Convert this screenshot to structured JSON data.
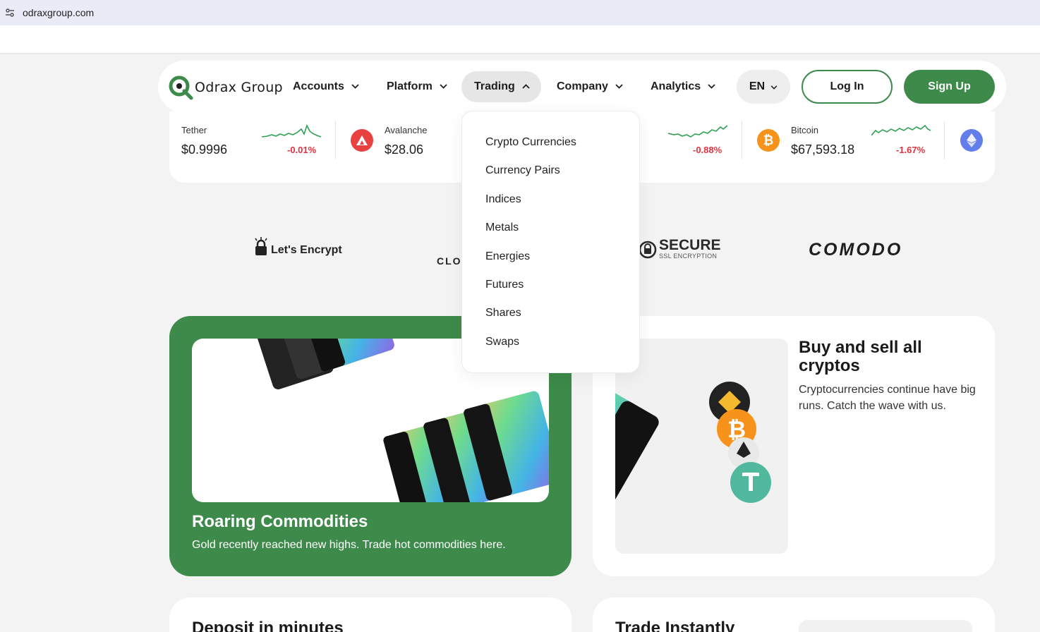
{
  "browser": {
    "url": "odraxgroup.com",
    "site_info_icon": "tune-icon"
  },
  "nav": {
    "logo_text": "Odrax Group",
    "logo_icon": "magnifier-logo-icon",
    "items": [
      {
        "label": "Accounts"
      },
      {
        "label": "Platform"
      },
      {
        "label": "Trading"
      },
      {
        "label": "Company"
      },
      {
        "label": "Analytics"
      }
    ],
    "language": "EN",
    "login_label": "Log In",
    "signup_label": "Sign Up"
  },
  "ticker": [
    {
      "name": "Tether",
      "price": "$0.9996",
      "change": "-0.01%"
    },
    {
      "name": "Avalanche",
      "price": "$28.06",
      "change": ""
    },
    {
      "name": "",
      "price": "",
      "change": "-0.88%"
    },
    {
      "name": "Bitcoin",
      "price": "$67,593.18",
      "change": "-1.67%"
    }
  ],
  "partners": {
    "encrypt": "Let's Encrypt",
    "cloud": "CLO",
    "secure": "SECURE",
    "secure_sub": "SSL ENCRYPTION",
    "comodo": "COMODO"
  },
  "dropdown": {
    "items": [
      "Crypto Currencies",
      "Currency Pairs",
      "Indices",
      "Metals",
      "Energies",
      "Futures",
      "Shares",
      "Swaps"
    ]
  },
  "cards": {
    "commodities": {
      "title": "Roaring Commodities",
      "desc": "Gold recently reached new highs. Trade hot commodities here."
    },
    "crypto": {
      "title": "Buy and sell all cryptos",
      "desc": "Cryptocurrencies continue have big runs. Catch the wave with us."
    },
    "deposit": {
      "title": "Deposit in minutes"
    },
    "trade": {
      "title": "Trade Instantly"
    }
  },
  "colors": {
    "brand_green": "#3d8a4a",
    "negative_red": "#e0333f",
    "bitcoin_orange": "#f7931a",
    "avalanche_red": "#e84142",
    "ethereum_blue": "#627eea"
  }
}
